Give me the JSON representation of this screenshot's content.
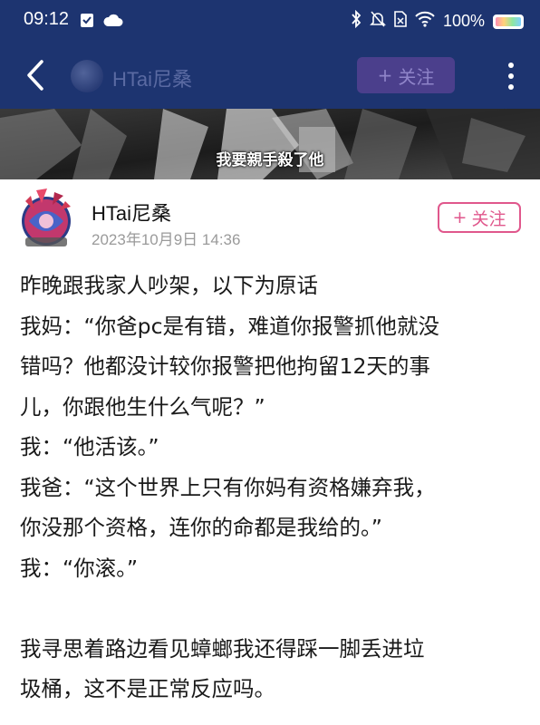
{
  "status_bar": {
    "time": "09:12",
    "battery": "100%",
    "battery_level": 1.0
  },
  "nav": {
    "title": "HTai尼桑",
    "follow_label": "关注",
    "follow_plus": "+"
  },
  "banner": {
    "caption": "我要親手殺了他"
  },
  "post": {
    "author": "HTai尼桑",
    "timestamp": "2023年10月9日 14:36",
    "follow_label": "关注",
    "follow_plus": "+",
    "lines": [
      "昨晚跟我家人吵架，以下为原话",
      "我妈：“你爸pc是有错，难道你报警抓他就没",
      "错吗？他都没计较你报警把他拘留12天的事",
      "儿，你跟他生什么气呢？”",
      "我：“他活该。”",
      "我爸：“这个世界上只有你妈有资格嫌弃我，",
      "你没那个资格，连你的命都是我给的。”",
      "我：“你滚。”",
      "",
      "我寻思着路边看见蟑螂我还得踩一脚丢进垃",
      "圾桶，这不是正常反应吗。"
    ]
  },
  "colors": {
    "nav_bg": "#1d3470",
    "follow_accent": "#e0578c",
    "nav_follow_bg": "#4b3f8c"
  },
  "icons": [
    "back-icon",
    "more-icon",
    "wifi-icon",
    "bluetooth-icon",
    "mute-icon",
    "sim-icon",
    "battery-icon",
    "cloud-icon",
    "notification-icon"
  ]
}
